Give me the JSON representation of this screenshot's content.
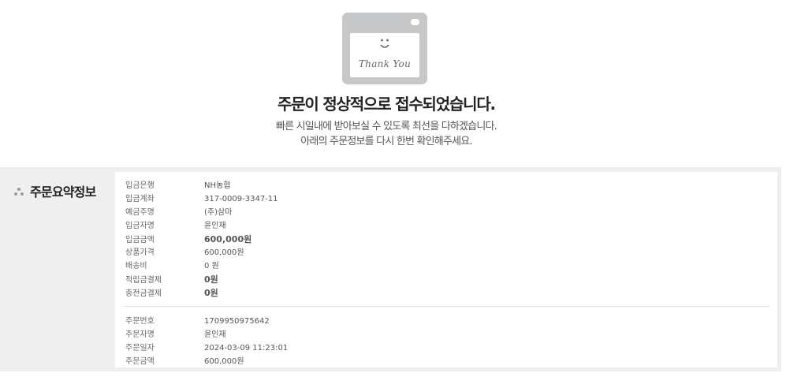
{
  "hero": {
    "image_text": "Thank You",
    "title": "주문이 정상적으로 접수되었습니다.",
    "line1": "빠른 시일내에 받아보실 수 있도록 최선을 다하겠습니다.",
    "line2": "아래의 주문정보를 다시 한번 확인해주세요."
  },
  "summary": {
    "title": "주문요약정보",
    "payment_rows": [
      {
        "label": "입금은행",
        "value": "NH농협",
        "bold": false
      },
      {
        "label": "입금계좌",
        "value": "317-0009-3347-11",
        "bold": false
      },
      {
        "label": "예금주명",
        "value": "(주)삼마",
        "bold": false
      },
      {
        "label": "입금자명",
        "value": "윤인재",
        "bold": false
      },
      {
        "label": "입금금액",
        "value": "600,000원",
        "bold": true
      },
      {
        "label": "상품가격",
        "value": "600,000원",
        "bold": false
      },
      {
        "label": "배송비",
        "value": "0 원",
        "bold": false
      },
      {
        "label": "적립금결제",
        "value": "0원",
        "bold": true
      },
      {
        "label": "충전금결제",
        "value": "0원",
        "bold": true
      }
    ],
    "order_rows": [
      {
        "label": "주문번호",
        "value": "1709950975642",
        "bold": false
      },
      {
        "label": "주문자명",
        "value": "윤인재",
        "bold": false
      },
      {
        "label": "주문일자",
        "value": "2024-03-09 11:23:01",
        "bold": false
      },
      {
        "label": "주문금액",
        "value": "600,000원",
        "bold": false
      }
    ]
  },
  "icons": {
    "illustration": "thank-you-browser-illustration",
    "bullets": "three-dot-bullet-icon"
  }
}
